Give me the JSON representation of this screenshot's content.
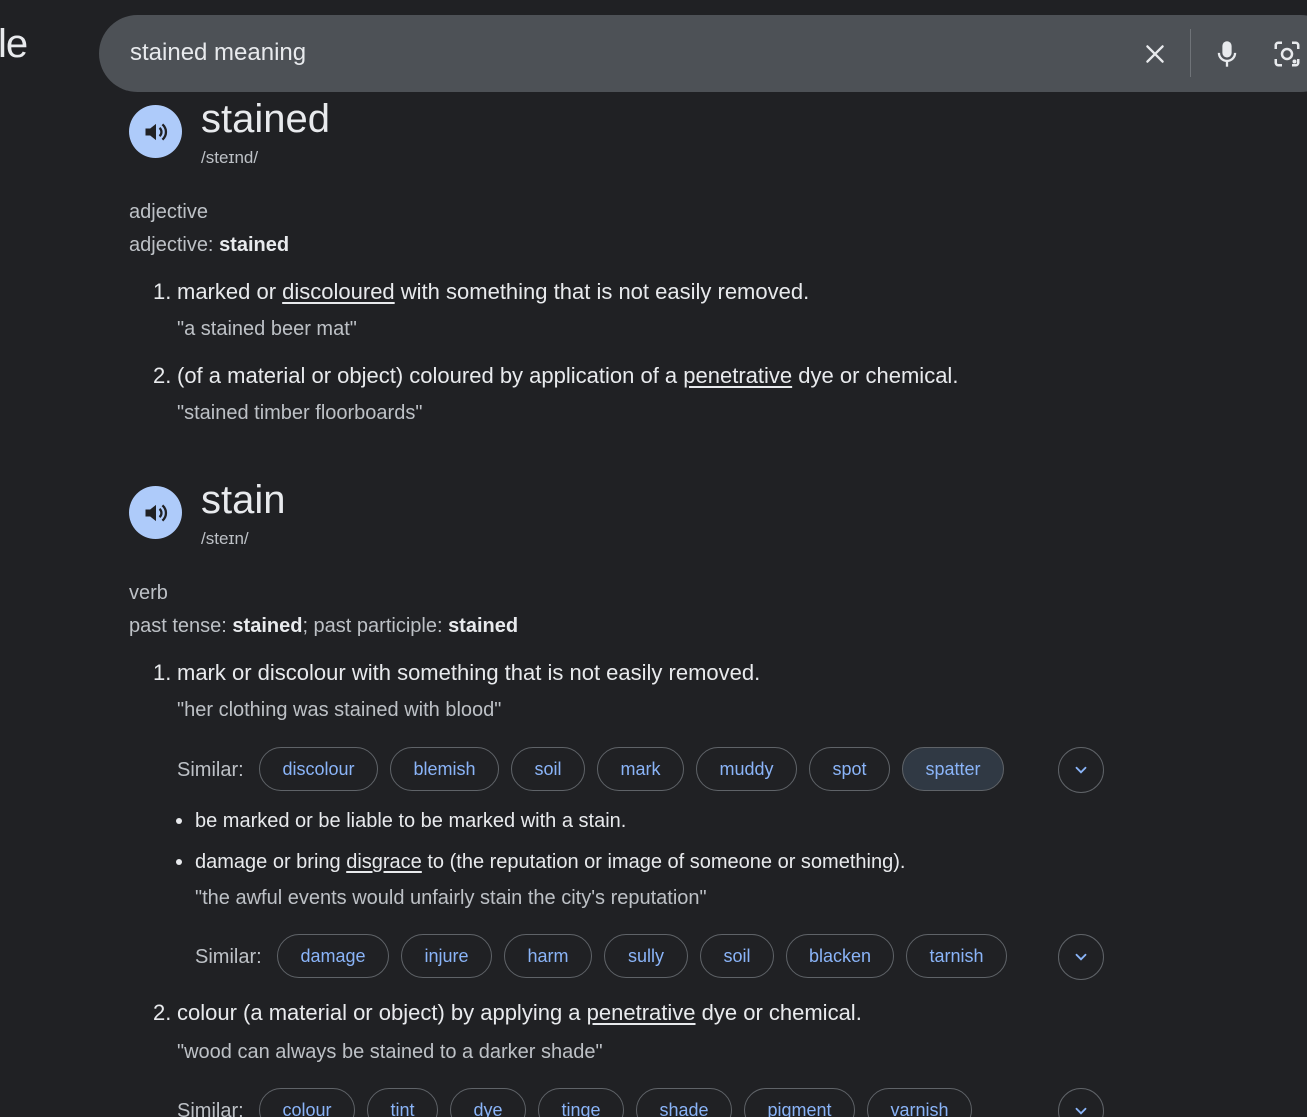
{
  "logo_partial": "le",
  "search": {
    "query": "stained meaning"
  },
  "icons": {
    "clear": "close-icon",
    "mic": "microphone-icon",
    "lens": "lens-camera-icon",
    "speaker": "speaker-icon",
    "expand": "chevron-down-icon"
  },
  "colors": {
    "background": "#202124",
    "searchbar": "#4d5156",
    "speaker_bg": "#aecbfa",
    "link": "#8ab4f8",
    "text": "#e8eaed",
    "muted": "#bdc1c6"
  },
  "entries": [
    {
      "headword": "stained",
      "phonetic": "/steɪnd/",
      "pos": "adjective",
      "forms_label": "adjective: ",
      "forms_value": "stained",
      "senses": [
        {
          "num": "1.",
          "pre": "marked or ",
          "link": "discoloured",
          "post": " with something that is not easily removed.",
          "example": "\"a stained beer mat\""
        },
        {
          "num": "2.",
          "pre": "(of a material or object) coloured by application of a ",
          "link": "penetrative",
          "post": " dye or chemical.",
          "example": "\"stained timber floorboards\""
        }
      ]
    },
    {
      "headword": "stain",
      "phonetic": "/steɪn/",
      "pos": "verb",
      "forms_label1": "past tense: ",
      "forms_value1": "stained",
      "forms_label2": "; past participle: ",
      "forms_value2": "stained",
      "senses": [
        {
          "num": "1.",
          "text": "mark or discolour with something that is not easily removed.",
          "example": "\"her clothing was stained with blood\"",
          "similar_label": "Similar:",
          "similar": [
            "discolour",
            "blemish",
            "soil",
            "mark",
            "muddy",
            "spot",
            "spatter"
          ],
          "subsenses": [
            {
              "text": "be marked or be liable to be marked with a stain."
            },
            {
              "pre": "damage or bring ",
              "link": "disgrace",
              "post": " to (the reputation or image of someone or something).",
              "example": "\"the awful events would unfairly stain the city's reputation\"",
              "similar_label": "Similar:",
              "similar": [
                "damage",
                "injure",
                "harm",
                "sully",
                "soil",
                "blacken",
                "tarnish"
              ]
            }
          ]
        },
        {
          "num": "2.",
          "pre": "colour (a material or object) by applying a ",
          "link": "penetrative",
          "post": " dye or chemical.",
          "example": "\"wood can always be stained to a darker shade\"",
          "similar_label": "Similar:",
          "similar": [
            "colour",
            "tint",
            "dye",
            "tinge",
            "shade",
            "pigment",
            "varnish"
          ]
        }
      ]
    }
  ]
}
